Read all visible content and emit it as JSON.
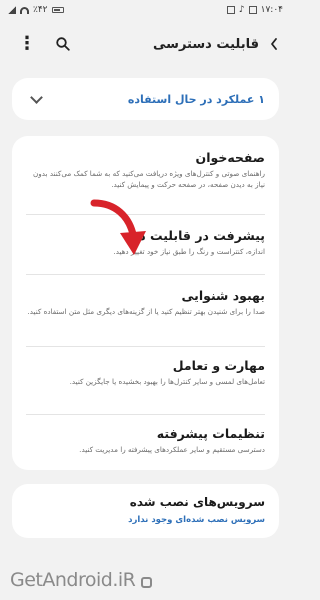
{
  "status_bar": {
    "time": "۱۷:۰۴",
    "battery": "٪۴۲"
  },
  "header": {
    "title": "قابلیت دسترسی"
  },
  "active_services": {
    "label": "۱ عملکرد در حال استفاده"
  },
  "items": [
    {
      "title": "صفحه‌خوان",
      "description": "راهنمای صوتی و کنترل‌های ویژه دریافت می‌کنید که به شما کمک می‌کنند بدون نیاز به دیدن صفحه، در صفحه حرکت و پیمایش کنید."
    },
    {
      "title": "پیشرفت در قابلیت دید",
      "description": "اندازه، کنتراست و رنگ را طبق نیاز خود تغییر دهید."
    },
    {
      "title": "بهبود شنوایی",
      "description": "صدا را برای شنیدن بهتر تنظیم کنید یا از گزینه‌های دیگری مثل متن استفاده کنید."
    },
    {
      "title": "مهارت و تعامل",
      "description": "تعامل‌های لمسی و سایر کنترل‌ها را بهبود بخشیده یا جایگزین کنید."
    },
    {
      "title": "تنظیمات پیشرفته",
      "description": "دسترسی مستقیم و سایر عملکردهای پیشرفته را مدیریت کنید."
    }
  ],
  "installed_services": {
    "title": "سرویس‌های نصب شده",
    "subtitle": "سرویس نصب شده‌ای وجود ندارد"
  },
  "watermark": "GetAndroid.iR",
  "colors": {
    "accent": "#2d6fb8",
    "arrow": "#d8232a",
    "background": "#f2f2f2",
    "card": "#ffffff"
  }
}
